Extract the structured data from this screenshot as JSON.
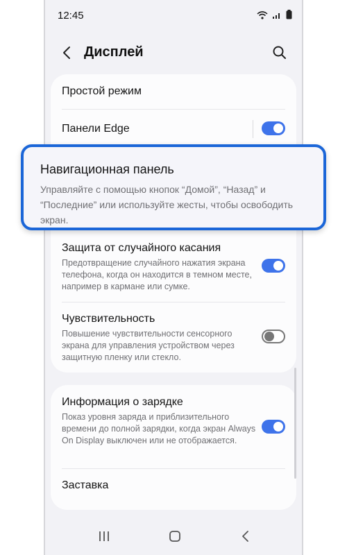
{
  "status_bar": {
    "time": "12:45"
  },
  "header": {
    "title": "Дисплей"
  },
  "settings": {
    "easy_mode": {
      "title": "Простой режим"
    },
    "edge_panels": {
      "title": "Панели Edge",
      "enabled": true
    },
    "navigation_bar": {
      "title": "Навигационная панель",
      "description": "Управляйте с помощью кнопок “Домой”, “Назад” и “Последние” или используйте жесты, чтобы освободить экран."
    },
    "accidental_touch": {
      "title": "Защита от случайного касания",
      "description": "Предотвращение случайного нажатия экрана телефона, когда он находится в темном месте, например в кармане или сумке.",
      "enabled": true
    },
    "touch_sensitivity": {
      "title": "Чувствительность",
      "description": "Повышение чувствительности сенсорного экрана для управления устройством через защитную пленку или стекло.",
      "enabled": false
    },
    "charging_info": {
      "title": "Информация о зарядке",
      "description": "Показ уровня заряда и приблизительного времени до полной зарядки, когда экран Always On Display выключен или не отображается.",
      "enabled": true
    },
    "screensaver": {
      "title": "Заставка"
    }
  },
  "colors": {
    "accent": "#3e73ea",
    "highlight_border": "#1b66d8"
  }
}
